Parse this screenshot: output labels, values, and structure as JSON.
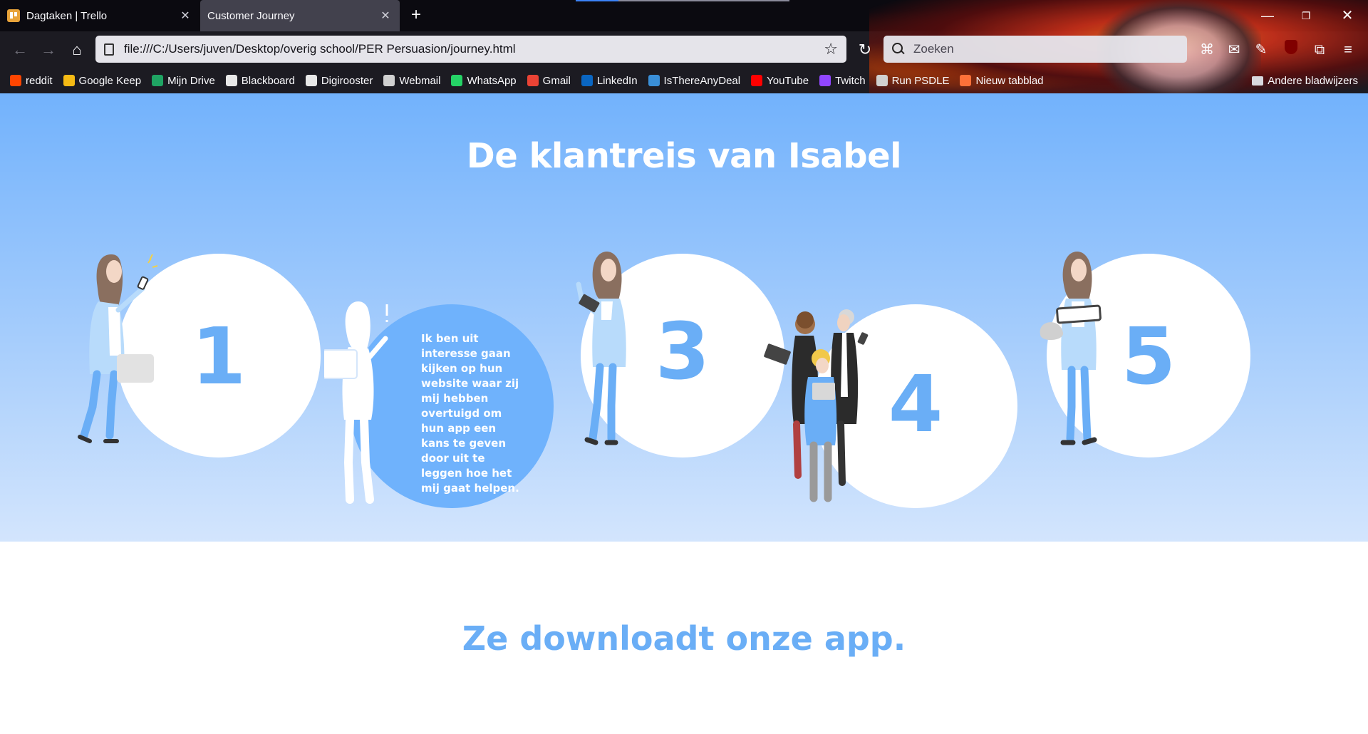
{
  "browser": {
    "tabs": [
      {
        "title": "Dagtaken | Trello",
        "close": "✕"
      },
      {
        "title": "Customer Journey",
        "close": "✕"
      }
    ],
    "new_tab": "+",
    "window_controls": {
      "minimize": "—",
      "maximize": "❐",
      "close": "✕"
    },
    "nav": {
      "back": "←",
      "forward": "→",
      "home": "⌂",
      "reload": "↻"
    },
    "url": "file:///C:/Users/juven/Desktop/overig school/PER Persuasion/journey.html",
    "bookmark_star": "☆",
    "search_placeholder": "Zoeken",
    "toolbar_icons": {
      "extensions": "⧉",
      "menu": "≡"
    },
    "bookmarks": [
      {
        "label": "reddit",
        "icon": "reddit-icon",
        "color": "#ff4500"
      },
      {
        "label": "Google Keep",
        "icon": "keep-icon",
        "color": "#f5ba14"
      },
      {
        "label": "Mijn Drive",
        "icon": "drive-icon",
        "color": "#1fa463"
      },
      {
        "label": "Blackboard",
        "icon": "blackboard-icon",
        "color": "#e8e8e8"
      },
      {
        "label": "Digirooster",
        "icon": "digirooster-icon",
        "color": "#e8e8e8"
      },
      {
        "label": "Webmail",
        "icon": "webmail-icon",
        "color": "#d0d0d0"
      },
      {
        "label": "WhatsApp",
        "icon": "whatsapp-icon",
        "color": "#25d366"
      },
      {
        "label": "Gmail",
        "icon": "gmail-icon",
        "color": "#ea4335"
      },
      {
        "label": "LinkedIn",
        "icon": "linkedin-icon",
        "color": "#0a66c2"
      },
      {
        "label": "IsThereAnyDeal",
        "icon": "isthereanydeal-icon",
        "color": "#3a8fd8"
      },
      {
        "label": "YouTube",
        "icon": "youtube-icon",
        "color": "#ff0000"
      },
      {
        "label": "Twitch",
        "icon": "twitch-icon",
        "color": "#9146ff"
      },
      {
        "label": "Run PSDLE",
        "icon": "globe-icon",
        "color": "#d0d0d0"
      },
      {
        "label": "Nieuw tabblad",
        "icon": "firefox-icon",
        "color": "#ff7139"
      }
    ],
    "other_bookmarks": "Andere bladwijzers"
  },
  "page": {
    "title": "De klantreis van Isabel",
    "steps": [
      {
        "number": "1"
      },
      {
        "text": "Ik ben uit interesse gaan kijken op hun website waar zij mij hebben overtuigd om hun app een kans te geven door uit te leggen hoe het mij gaat helpen."
      },
      {
        "number": "3"
      },
      {
        "number": "4"
      },
      {
        "number": "5"
      }
    ],
    "section_title": "Ze downloadt onze app."
  },
  "colors": {
    "accent": "#6aaef6",
    "hero_top": "#72b2fc",
    "hero_bottom": "#d3e5fd",
    "chrome_bg": "#1c1b22"
  }
}
